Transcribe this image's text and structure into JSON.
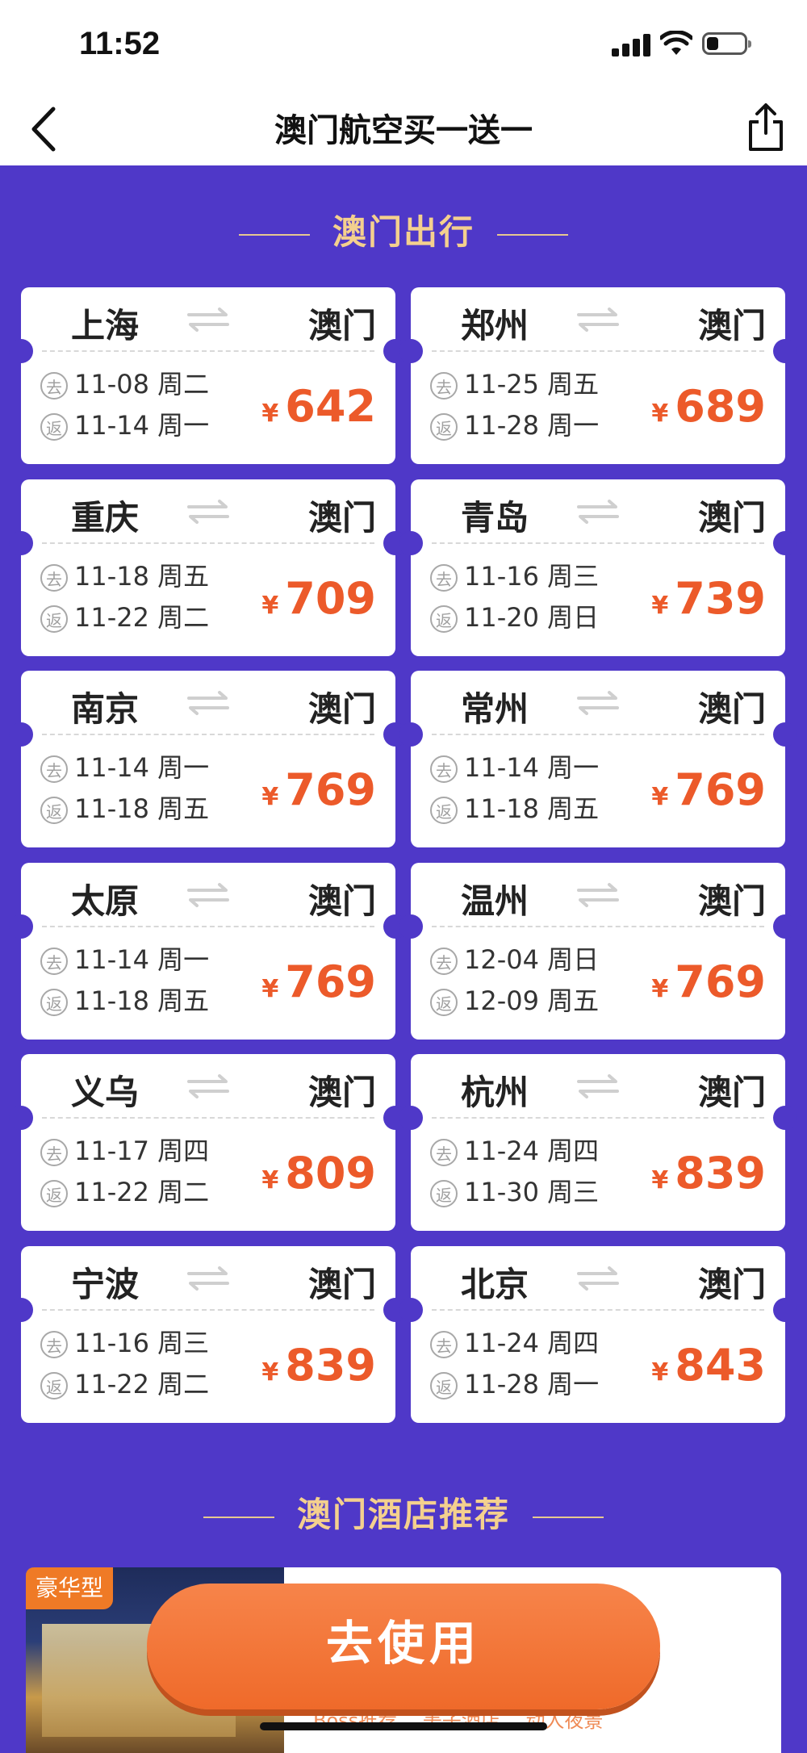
{
  "status": {
    "time": "11:52"
  },
  "nav": {
    "title": "澳门航空买一送一"
  },
  "section1": {
    "title": "澳门出行"
  },
  "labels": {
    "go": "去",
    "ret": "返",
    "currency": "¥"
  },
  "flights": [
    {
      "from": "上海",
      "to": "澳门",
      "go": "11-08 周二",
      "ret": "11-14 周一",
      "price": "642"
    },
    {
      "from": "郑州",
      "to": "澳门",
      "go": "11-25 周五",
      "ret": "11-28 周一",
      "price": "689"
    },
    {
      "from": "重庆",
      "to": "澳门",
      "go": "11-18 周五",
      "ret": "11-22 周二",
      "price": "709"
    },
    {
      "from": "青岛",
      "to": "澳门",
      "go": "11-16 周三",
      "ret": "11-20 周日",
      "price": "739"
    },
    {
      "from": "南京",
      "to": "澳门",
      "go": "11-14 周一",
      "ret": "11-18 周五",
      "price": "769"
    },
    {
      "from": "常州",
      "to": "澳门",
      "go": "11-14 周一",
      "ret": "11-18 周五",
      "price": "769"
    },
    {
      "from": "太原",
      "to": "澳门",
      "go": "11-14 周一",
      "ret": "11-18 周五",
      "price": "769"
    },
    {
      "from": "温州",
      "to": "澳门",
      "go": "12-04 周日",
      "ret": "12-09 周五",
      "price": "769"
    },
    {
      "from": "义乌",
      "to": "澳门",
      "go": "11-17 周四",
      "ret": "11-22 周二",
      "price": "809"
    },
    {
      "from": "杭州",
      "to": "澳门",
      "go": "11-24 周四",
      "ret": "11-30 周三",
      "price": "839"
    },
    {
      "from": "宁波",
      "to": "澳门",
      "go": "11-16 周三",
      "ret": "11-22 周二",
      "price": "839"
    },
    {
      "from": "北京",
      "to": "澳门",
      "go": "11-24 周四",
      "ret": "11-28 周一",
      "price": "843"
    }
  ],
  "section2": {
    "title": "澳门酒店推荐"
  },
  "hotel": {
    "badge": "豪华型",
    "tags": [
      "Boss推荐",
      "美子酒店",
      "动人夜景"
    ]
  },
  "cta": {
    "label": "去使用"
  },
  "colors": {
    "background": "#4f38c8",
    "price": "#ec5a2a",
    "accent": "#ef6a2a",
    "gold": "#f4d08e"
  },
  "icons": {
    "back": "chevron-left-icon",
    "share": "share-icon",
    "swap": "swap-arrows-icon"
  }
}
